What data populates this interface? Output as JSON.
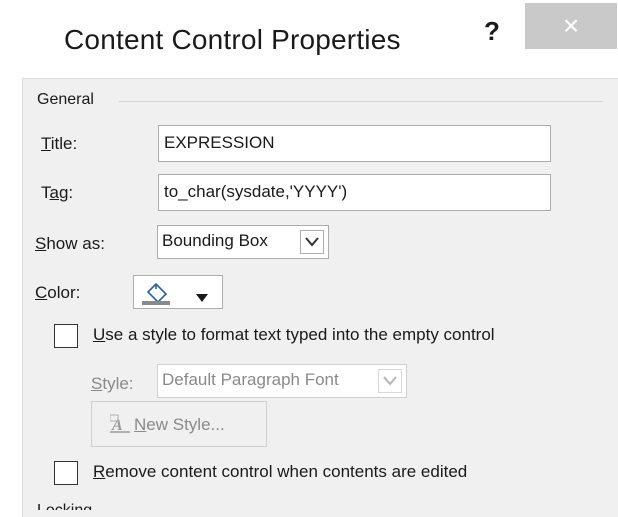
{
  "window": {
    "title": "Content Control Properties",
    "help_label": "?",
    "close_label": "×"
  },
  "general": {
    "group_label": "General",
    "title_label": "Title:",
    "title_value": "EXPRESSION",
    "tag_label": "Tag:",
    "tag_value": "to_char(sysdate,'YYYY')",
    "show_as_label": "Show as:",
    "show_as_value": "Bounding Box",
    "color_label": "Color:",
    "use_style_label": "Use a style to format text typed into the empty control",
    "use_style_checked": false,
    "style_label": "Style:",
    "style_value": "Default Paragraph Font",
    "new_style_label": "New Style...",
    "remove_label": "Remove content control when contents are edited",
    "remove_checked": false
  },
  "locking": {
    "group_label": "Locking"
  },
  "colors": {
    "close_bg": "#c9c9c9",
    "panel_bg": "#f0f0f0",
    "disabled_text": "#8a8a8a"
  }
}
